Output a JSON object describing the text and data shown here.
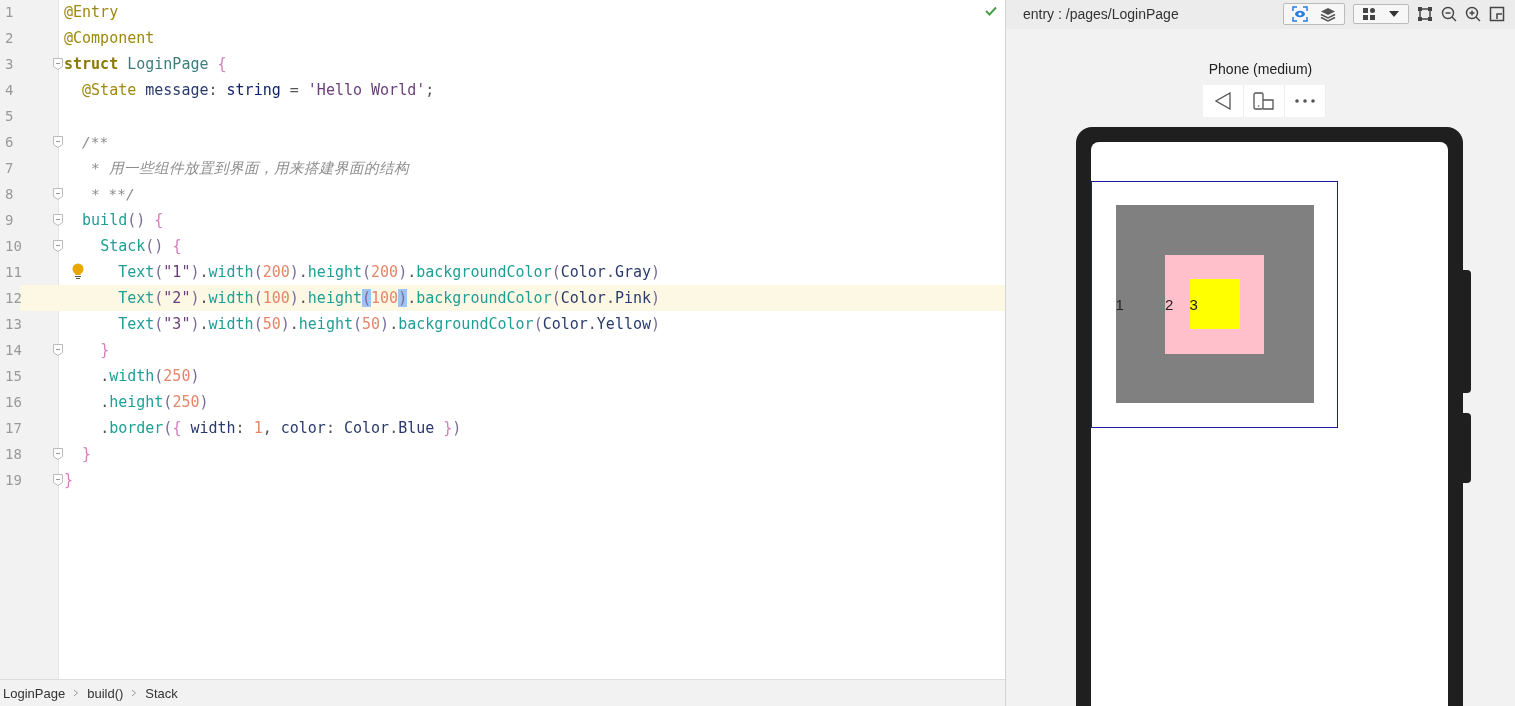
{
  "editor": {
    "lines": [
      {
        "n": "1",
        "fold": false,
        "hint": false,
        "current": false,
        "bracket_match": false,
        "text": "@Entry"
      },
      {
        "n": "2",
        "fold": false,
        "hint": false,
        "current": false,
        "bracket_match": false,
        "text": "@Component"
      },
      {
        "n": "3",
        "fold": true,
        "hint": false,
        "current": false,
        "bracket_match": false,
        "text": "struct LoginPage {"
      },
      {
        "n": "4",
        "fold": false,
        "hint": false,
        "current": false,
        "bracket_match": false,
        "text": "  @State message: string = 'Hello World';"
      },
      {
        "n": "5",
        "fold": false,
        "hint": false,
        "current": false,
        "bracket_match": false
      },
      {
        "n": "6",
        "fold": true,
        "hint": false,
        "current": false,
        "bracket_match": false,
        "text": "  /**"
      },
      {
        "n": "7",
        "fold": false,
        "hint": false,
        "current": false,
        "bracket_match": false,
        "text": "   * 用一些组件放置到界面，用来搭建界面的结构"
      },
      {
        "n": "8",
        "fold": true,
        "hint": false,
        "current": false,
        "bracket_match": false,
        "text": "   * **/"
      },
      {
        "n": "9",
        "fold": true,
        "hint": false,
        "current": false,
        "bracket_match": false,
        "text": "  build() {"
      },
      {
        "n": "10",
        "fold": true,
        "hint": false,
        "current": false,
        "bracket_match": false,
        "text": "    Stack() {"
      },
      {
        "n": "11",
        "fold": false,
        "hint": true,
        "current": false,
        "bracket_match": false,
        "text": "      Text(\"1\").width(200).height(200).backgroundColor(Color.Gray)"
      },
      {
        "n": "12",
        "fold": false,
        "hint": false,
        "current": true,
        "bracket_match": true,
        "text": "      Text(\"2\").width(100).height(100).backgroundColor(Color.Pink)"
      },
      {
        "n": "13",
        "fold": false,
        "hint": false,
        "current": false,
        "bracket_match": false,
        "text": "      Text(\"3\").width(50).height(50).backgroundColor(Color.Yellow)"
      },
      {
        "n": "14",
        "fold": true,
        "hint": false,
        "current": false,
        "bracket_match": false,
        "text": "    }"
      },
      {
        "n": "15",
        "fold": false,
        "hint": false,
        "current": false,
        "bracket_match": false,
        "text": "    .width(250)"
      },
      {
        "n": "16",
        "fold": false,
        "hint": false,
        "current": false,
        "bracket_match": false,
        "text": "    .height(250)"
      },
      {
        "n": "17",
        "fold": false,
        "hint": false,
        "current": false,
        "bracket_match": false,
        "text": "    .border({ width: 1, color: Color.Blue })"
      },
      {
        "n": "18",
        "fold": true,
        "hint": false,
        "current": false,
        "bracket_match": false,
        "text": "  }"
      },
      {
        "n": "19",
        "fold": true,
        "hint": false,
        "current": false,
        "bracket_match": false,
        "text": "}"
      }
    ],
    "breadcrumbs": [
      "LoginPage",
      "build()",
      "Stack"
    ]
  },
  "preview": {
    "title": "entry : /pages/LoginPage",
    "device": "Phone (medium)",
    "stack": {
      "children": [
        {
          "text": "1",
          "color": "#808080"
        },
        {
          "text": "2",
          "color": "#ffc0cb"
        },
        {
          "text": "3",
          "color": "#ffff00"
        }
      ]
    }
  }
}
